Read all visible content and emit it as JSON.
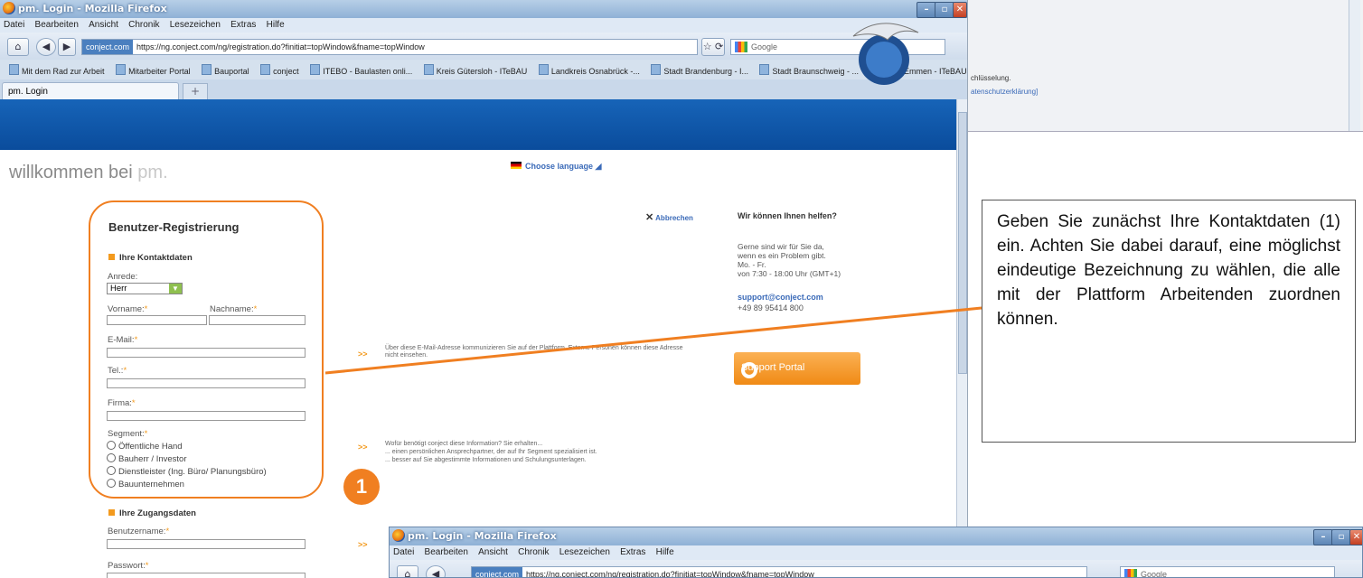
{
  "window": {
    "title": "pm. Login - Mozilla Firefox",
    "menu": [
      "Datei",
      "Bearbeiten",
      "Ansicht",
      "Chronik",
      "Lesezeichen",
      "Extras",
      "Hilfe"
    ],
    "url_badge": "conject.com",
    "url": "https://ng.conject.com/ng/registration.do?finitiat=topWindow&fname=topWindow",
    "search_placeholder": "Google",
    "bookmarks": [
      "Mit dem Rad zur Arbeit",
      "Mitarbeiter Portal",
      "Bauportal",
      "conject",
      "ITEBO - Baulasten onli...",
      "Kreis Gütersloh - ITeBAU",
      "Landkreis Osnabrück -...",
      "Stadt Brandenburg - I...",
      "Stadt Braunschweig - ...",
      "Stadt Emmen - ITeBAU"
    ],
    "tab": "pm. Login",
    "new_tab": "+"
  },
  "page": {
    "welcome_prefix": "willkommen bei",
    "welcome_brand": "pm.",
    "language": "Choose language",
    "form_title": "Benutzer-Registrierung",
    "section_contact": "Ihre Kontaktdaten",
    "anrede_label": "Anrede:",
    "anrede_value": "Herr",
    "vorname_label": "Vorname:",
    "nachname_label": "Nachname:",
    "email_label": "E-Mail:",
    "tel_label": "Tel.:",
    "firma_label": "Firma:",
    "segment_label": "Segment:",
    "segments": [
      "Öffentliche Hand",
      "Bauherr / Investor",
      "Dienstleister (Ing. Büro/ Planungsbüro)",
      "Bauunternehmen"
    ],
    "section_access": "Ihre Zugangsdaten",
    "benutzername_label": "Benutzername:",
    "passwort_label": "Passwort:",
    "required_mark": "*",
    "arrow": ">>",
    "email_info": "Über diese E-Mail-Adresse kommunizieren Sie auf der Plattform. Externe Personen können diese Adresse nicht einsehen.",
    "segment_info_1": "Wofür benötigt conject diese Information? Sie erhalten...",
    "segment_info_2": "... einen persönlichen Ansprechpartner, der auf Ihr Segment spezialisiert ist.",
    "segment_info_3": "... besser auf Sie abgestimmte Informationen und Schulungsunterlagen.",
    "cancel": "Abbrechen",
    "help_title": "Wir können Ihnen helfen?",
    "help_1": "Gerne sind wir für Sie da,",
    "help_2": "wenn es ein Problem gibt.",
    "help_3": "Mo. - Fr.",
    "help_4": "von 7:30 - 18:00 Uhr (GMT+1)",
    "support_email": "support@conject.com",
    "support_phone": "+49 89 95414 800",
    "support_button": "Support Portal"
  },
  "annotation": {
    "number": "1",
    "callout": "Geben Sie zunächst Ihre Kontaktdaten (1) ein. Achten Sie dabei darauf, eine möglichst eindeutige Bezeichnung zu wählen, die alle mit der Plattform Arbeitenden zuordnen können.",
    "color": "#f07f21"
  },
  "background_window": {
    "text_1": "chlüsselung.",
    "text_2": "atenschutzerklärung]",
    "chevron": "»"
  }
}
